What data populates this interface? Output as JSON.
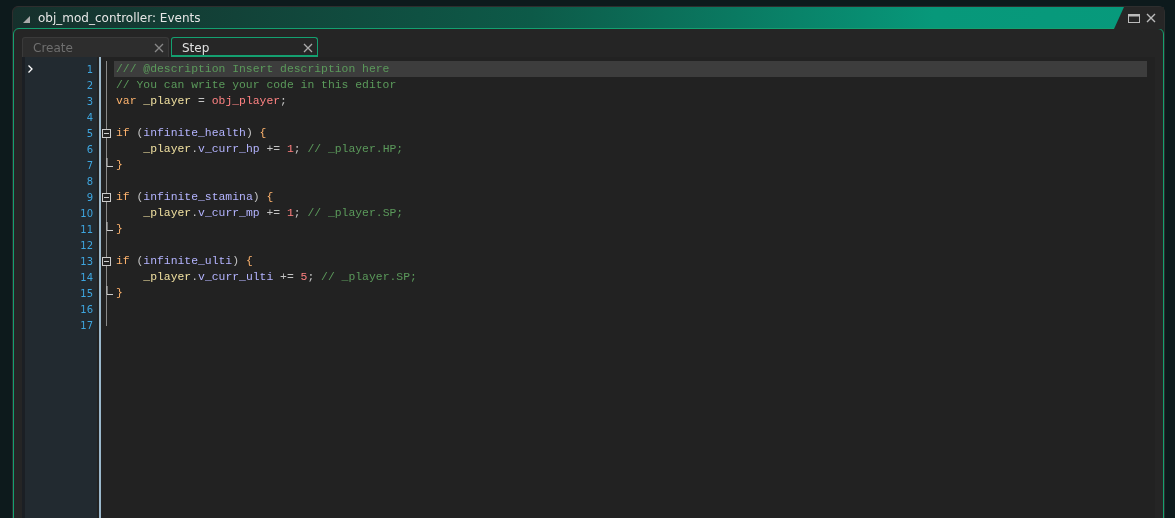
{
  "window": {
    "title": "obj_mod_controller: Events"
  },
  "tabs": [
    {
      "label": "Create",
      "selected": false
    },
    {
      "label": "Step",
      "selected": true
    }
  ],
  "editor": {
    "lines": [
      {
        "number": "1",
        "current": true,
        "fold_start": false,
        "fold_end": false,
        "tokens": [
          {
            "kind": "comment",
            "text": "/// @description Insert description here"
          }
        ]
      },
      {
        "number": "2",
        "current": false,
        "fold_start": false,
        "fold_end": false,
        "tokens": [
          {
            "kind": "comment",
            "text": "// You can write your code in this editor"
          }
        ]
      },
      {
        "number": "3",
        "current": false,
        "fold_start": false,
        "fold_end": false,
        "tokens": [
          {
            "kind": "keyword",
            "text": "var"
          },
          {
            "kind": "local",
            "text": " _player"
          },
          {
            "kind": "plain",
            "text": " = "
          },
          {
            "kind": "asset",
            "text": "obj_player"
          },
          {
            "kind": "plain",
            "text": ";"
          }
        ]
      },
      {
        "number": "4",
        "current": false,
        "fold_start": false,
        "fold_end": false
      },
      {
        "number": "5",
        "current": false,
        "fold_start": true,
        "fold_end": false,
        "tokens": [
          {
            "kind": "keyword",
            "text": "if"
          },
          {
            "kind": "plain",
            "text": " ("
          },
          {
            "kind": "instance",
            "text": "infinite_health"
          },
          {
            "kind": "plain",
            "text": ") "
          },
          {
            "kind": "brace",
            "text": "{"
          }
        ]
      },
      {
        "number": "6",
        "current": false,
        "fold_start": false,
        "fold_end": false,
        "tokens": [
          {
            "kind": "local",
            "text": "    _player"
          },
          {
            "kind": "plain",
            "text": "."
          },
          {
            "kind": "instance",
            "text": "v_curr_hp"
          },
          {
            "kind": "plain",
            "text": " += "
          },
          {
            "kind": "number",
            "text": "1"
          },
          {
            "kind": "plain",
            "text": "; "
          },
          {
            "kind": "comment",
            "text": "// _player.HP;"
          }
        ]
      },
      {
        "number": "7",
        "current": false,
        "fold_start": false,
        "fold_end": true,
        "tokens": [
          {
            "kind": "brace",
            "text": "}"
          }
        ]
      },
      {
        "number": "8",
        "current": false,
        "fold_start": false,
        "fold_end": false
      },
      {
        "number": "9",
        "current": false,
        "fold_start": true,
        "fold_end": false,
        "tokens": [
          {
            "kind": "keyword",
            "text": "if"
          },
          {
            "kind": "plain",
            "text": " ("
          },
          {
            "kind": "instance",
            "text": "infinite_stamina"
          },
          {
            "kind": "plain",
            "text": ") "
          },
          {
            "kind": "brace",
            "text": "{"
          }
        ]
      },
      {
        "number": "10",
        "current": false,
        "fold_start": false,
        "fold_end": false,
        "tokens": [
          {
            "kind": "local",
            "text": "    _player"
          },
          {
            "kind": "plain",
            "text": "."
          },
          {
            "kind": "instance",
            "text": "v_curr_mp"
          },
          {
            "kind": "plain",
            "text": " += "
          },
          {
            "kind": "number",
            "text": "1"
          },
          {
            "kind": "plain",
            "text": "; "
          },
          {
            "kind": "comment",
            "text": "// _player.SP;"
          }
        ]
      },
      {
        "number": "11",
        "current": false,
        "fold_start": false,
        "fold_end": true,
        "tokens": [
          {
            "kind": "brace",
            "text": "}"
          }
        ]
      },
      {
        "number": "12",
        "current": false,
        "fold_start": false,
        "fold_end": false
      },
      {
        "number": "13",
        "current": false,
        "fold_start": true,
        "fold_end": false,
        "tokens": [
          {
            "kind": "keyword",
            "text": "if"
          },
          {
            "kind": "plain",
            "text": " ("
          },
          {
            "kind": "instance",
            "text": "infinite_ulti"
          },
          {
            "kind": "plain",
            "text": ") "
          },
          {
            "kind": "brace",
            "text": "{"
          }
        ]
      },
      {
        "number": "14",
        "current": false,
        "fold_start": false,
        "fold_end": false,
        "tokens": [
          {
            "kind": "local",
            "text": "    _player"
          },
          {
            "kind": "plain",
            "text": "."
          },
          {
            "kind": "instance",
            "text": "v_curr_ulti"
          },
          {
            "kind": "plain",
            "text": " += "
          },
          {
            "kind": "number",
            "text": "5"
          },
          {
            "kind": "plain",
            "text": "; "
          },
          {
            "kind": "comment",
            "text": "// _player.SP;"
          }
        ]
      },
      {
        "number": "15",
        "current": false,
        "fold_start": false,
        "fold_end": true,
        "tokens": [
          {
            "kind": "brace",
            "text": "}"
          }
        ]
      },
      {
        "number": "16",
        "current": false,
        "fold_start": false,
        "fold_end": false
      },
      {
        "number": "17",
        "current": false,
        "fold_start": false,
        "fold_end": false
      }
    ]
  }
}
